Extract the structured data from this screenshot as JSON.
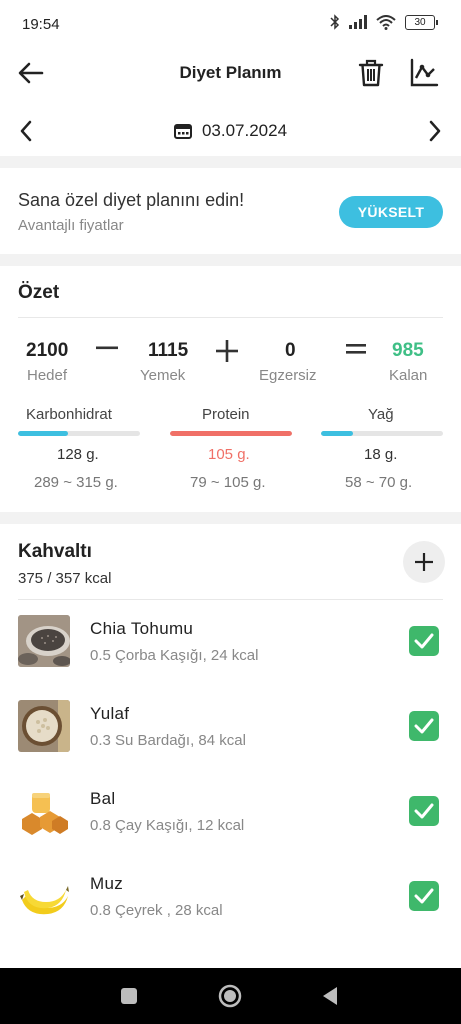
{
  "status": {
    "time": "19:54",
    "battery": "30"
  },
  "header": {
    "title": "Diyet Planım"
  },
  "date": {
    "value": "03.07.2024"
  },
  "promo": {
    "title": "Sana özel diyet planını edin!",
    "subtitle": "Avantajlı fiyatlar",
    "button": "YÜKSELT"
  },
  "summary": {
    "title": "Özet",
    "goal": {
      "value": "2100",
      "label": "Hedef"
    },
    "food": {
      "value": "1115",
      "label": "Yemek"
    },
    "exercise": {
      "value": "0",
      "label": "Egzersiz"
    },
    "remaining": {
      "value": "985",
      "label": "Kalan"
    },
    "macros": [
      {
        "label": "Karbonhidrat",
        "value": "128 g.",
        "range": "289 ~ 315 g.",
        "progress": 0.41,
        "color": "#3dbfe0",
        "value_color": "#333333"
      },
      {
        "label": "Protein",
        "value": "105 g.",
        "range": "79 ~ 105 g.",
        "progress": 1.0,
        "color": "#f07067",
        "value_color": "#f07067"
      },
      {
        "label": "Yağ",
        "value": "18 g.",
        "range": "58 ~ 70 g.",
        "progress": 0.26,
        "color": "#3dbfe0",
        "value_color": "#333333"
      }
    ]
  },
  "meal": {
    "title": "Kahvaltı",
    "kcal": "375 / 357 kcal",
    "items": [
      {
        "name": "Chia Tohumu",
        "detail": "0.5 Çorba Kaşığı, 24 kcal",
        "icon": "chia-seeds-image",
        "checked": true
      },
      {
        "name": "Yulaf",
        "detail": "0.3 Su Bardağı, 84 kcal",
        "icon": "oats-image",
        "checked": true
      },
      {
        "name": "Bal",
        "detail": "0.8 Çay Kaşığı, 12 kcal",
        "icon": "honey-image",
        "checked": true
      },
      {
        "name": "Muz",
        "detail": "0.8 Çeyrek , 28 kcal",
        "icon": "banana-image",
        "checked": true
      }
    ]
  },
  "colors": {
    "accent": "#3dbfe0",
    "remaining": "#3fbf86",
    "check": "#3fb86b",
    "protein": "#f07067"
  }
}
